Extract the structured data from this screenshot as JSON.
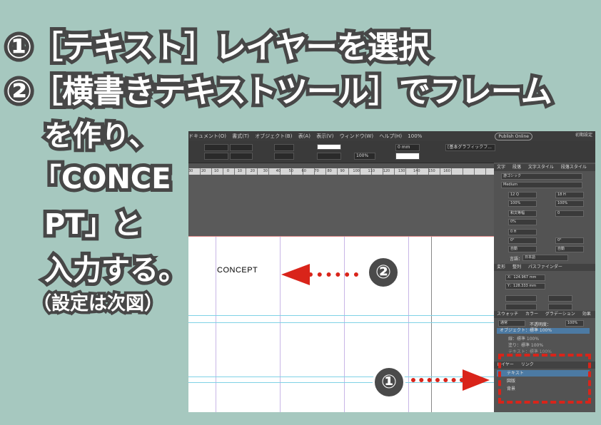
{
  "headline": {
    "line1": "①［テキスト］レイヤーを選択",
    "line2": "②［横書きテキストツール］でフレーム",
    "line3": "を作り、",
    "line4": "「CONCE",
    "line5": "PT」と",
    "line6": "入力する。",
    "line7": "（設定は次図）"
  },
  "markers": {
    "one": "①",
    "two": "②"
  },
  "app": {
    "menu": [
      "ドキュメント(O)",
      "書式(T)",
      "オブジェクト(B)",
      "表(A)",
      "表示(V)",
      "ウィンドウ(W)",
      "ヘルプ(H)"
    ],
    "zoom": "100%",
    "publish": "Publish Online",
    "workspace": "初期設定",
    "control": {
      "stroke_value": "0 mm",
      "scale_value": "100%",
      "frame_style": "[基本グラフィックフ..."
    },
    "ruler_ticks": [
      "30",
      "20",
      "10",
      "0",
      "10",
      "20",
      "30",
      "40",
      "50",
      "60",
      "70",
      "80",
      "90",
      "100",
      "110",
      "120",
      "130",
      "140",
      "150",
      "160"
    ],
    "document_text": "CONCEPT"
  },
  "panel": {
    "char_tabs": [
      "文字",
      "段落",
      "文字スタイル",
      "段落スタイル"
    ],
    "font_family": "游ゴシック",
    "font_style": "Medium",
    "size": "12 Q",
    "leading": "18 H",
    "vscale": "100%",
    "hscale": "100%",
    "kerning": "和文等幅",
    "tracking": "0",
    "tsume": "0%",
    "baseline": "0 H",
    "rotation": "0°",
    "skew": "0°",
    "aki_left": "自動",
    "aki_right": "自動",
    "language_label": "言語：",
    "language": "日本語",
    "transform_tabs": [
      "変形",
      "整列",
      "パスファインダー"
    ],
    "x_val": "X：124.967 mm",
    "y_val": "Y：128.333 mm",
    "effect_tabs": [
      "スウォッチ",
      "カラー",
      "グラデーション",
      "効果"
    ],
    "blend_mode": "通常",
    "opacity_label": "不透明度：",
    "opacity": "100%",
    "effect_rows": [
      "オブジェクト：標準 100%",
      "線：標準 100%",
      "塗り：標準 100%",
      "テキスト：標準 100%"
    ],
    "layer_tabs": [
      "レイヤー",
      "リンク"
    ],
    "layers": [
      "テキスト",
      "図版",
      "背景"
    ]
  }
}
